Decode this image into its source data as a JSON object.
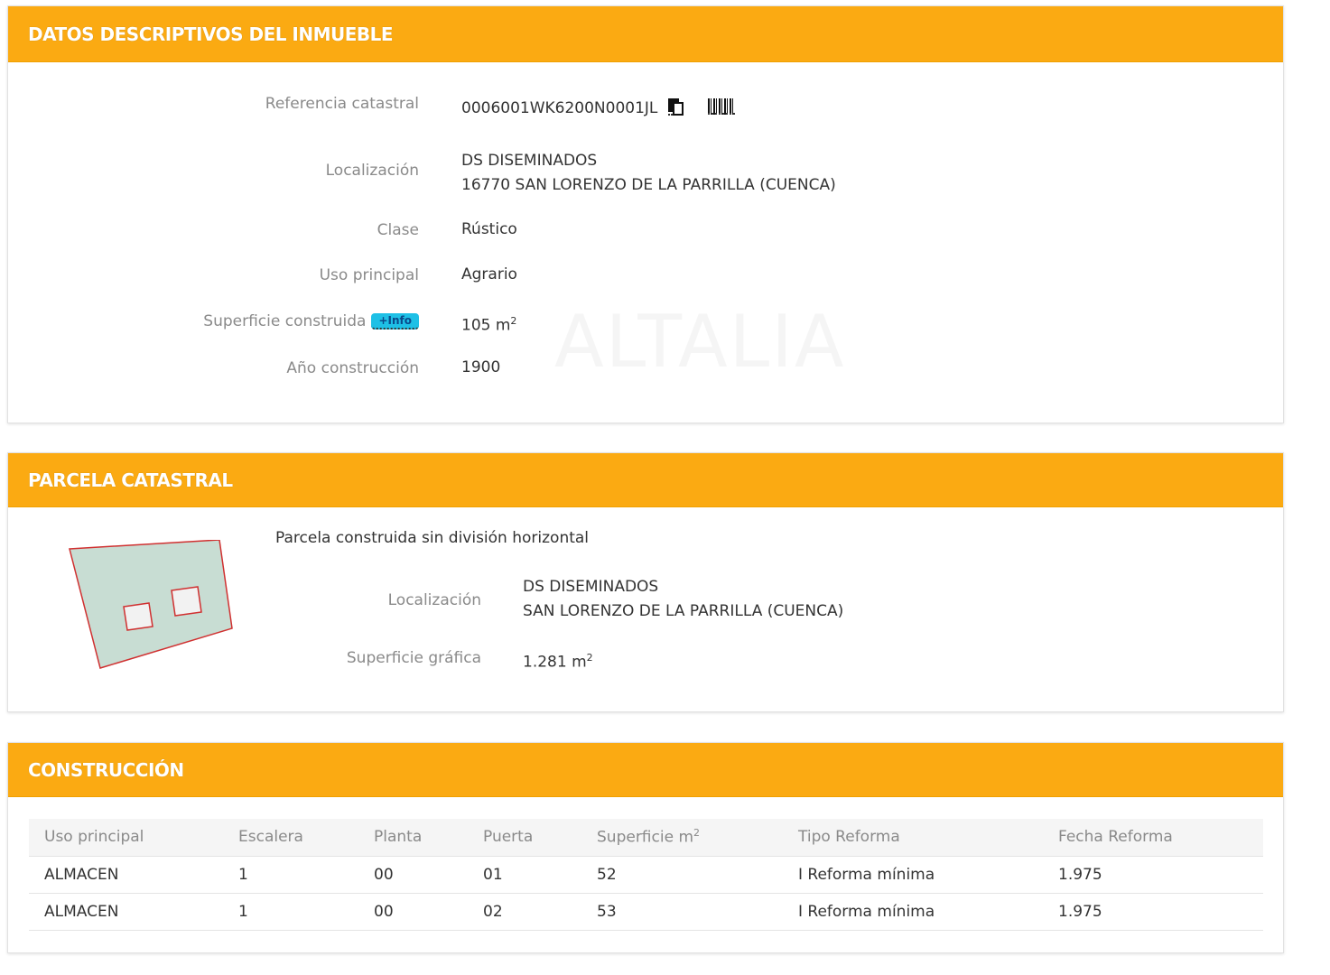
{
  "datos": {
    "header": "DATOS DESCRIPTIVOS DEL INMUEBLE",
    "referencia_label": "Referencia catastral",
    "referencia_value": "0006001WK6200N0001JL",
    "localizacion_label": "Localización",
    "localizacion_line1": "DS DISEMINADOS",
    "localizacion_line2": "16770 SAN LORENZO DE LA PARRILLA (CUENCA)",
    "clase_label": "Clase",
    "clase_value": "Rústico",
    "uso_label": "Uso principal",
    "uso_value": "Agrario",
    "superficie_label": "Superficie construida",
    "info_badge": "+Info",
    "superficie_value": "105 m",
    "superficie_unit_exp": "2",
    "anio_label": "Año construcción",
    "anio_value": "1900",
    "watermark": "ALTALIA"
  },
  "parcela": {
    "header": "PARCELA CATASTRAL",
    "title": "Parcela construida sin división horizontal",
    "localizacion_label": "Localización",
    "localizacion_line1": "DS DISEMINADOS",
    "localizacion_line2": "SAN LORENZO DE LA PARRILLA (CUENCA)",
    "superficie_label": "Superficie gráfica",
    "superficie_value": "1.281 m",
    "superficie_unit_exp": "2",
    "colors": {
      "fill": "#c8ddd3",
      "stroke": "#d03030"
    }
  },
  "construccion": {
    "header": "CONSTRUCCIÓN",
    "columns": [
      "Uso principal",
      "Escalera",
      "Planta",
      "Puerta",
      "Superficie m",
      "Tipo Reforma",
      "Fecha Reforma"
    ],
    "superficie_col_exp": "2",
    "rows": [
      [
        "ALMACEN",
        "1",
        "00",
        "01",
        "52",
        "I Reforma mínima",
        "1.975"
      ],
      [
        "ALMACEN",
        "1",
        "00",
        "02",
        "53",
        "I Reforma mínima",
        "1.975"
      ]
    ]
  },
  "theme": {
    "accent": "#fbaa12",
    "info_badge": "#1ec0e6"
  }
}
